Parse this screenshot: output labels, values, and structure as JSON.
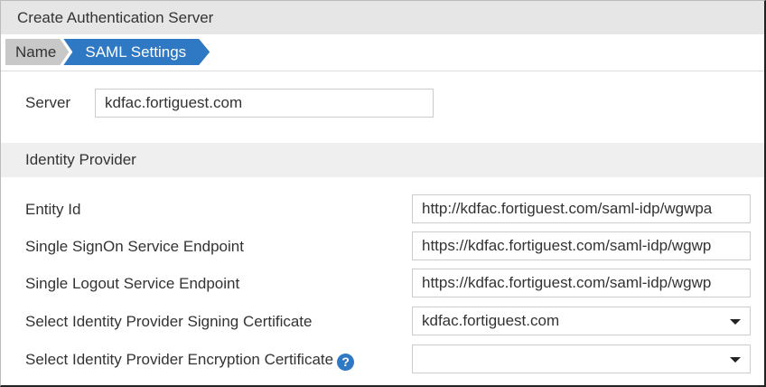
{
  "dialog": {
    "title": "Create Authentication Server"
  },
  "breadcrumb": [
    {
      "label": "Name"
    },
    {
      "label": "SAML Settings"
    }
  ],
  "server": {
    "label": "Server",
    "value": "kdfac.fortiguest.com"
  },
  "identity_provider": {
    "heading": "Identity Provider",
    "entity_id": {
      "label": "Entity Id",
      "value": "http://kdfac.fortiguest.com/saml-idp/wgwpa"
    },
    "sso_endpoint": {
      "label": "Single SignOn Service Endpoint",
      "value": "https://kdfac.fortiguest.com/saml-idp/wgwp"
    },
    "slo_endpoint": {
      "label": "Single Logout Service Endpoint",
      "value": "https://kdfac.fortiguest.com/saml-idp/wgwp"
    },
    "signing_cert": {
      "label": "Select Identity Provider Signing Certificate",
      "value": "kdfac.fortiguest.com"
    },
    "encryption_cert": {
      "label": "Select Identity Provider Encryption Certificate",
      "value": "",
      "help": "?"
    }
  }
}
